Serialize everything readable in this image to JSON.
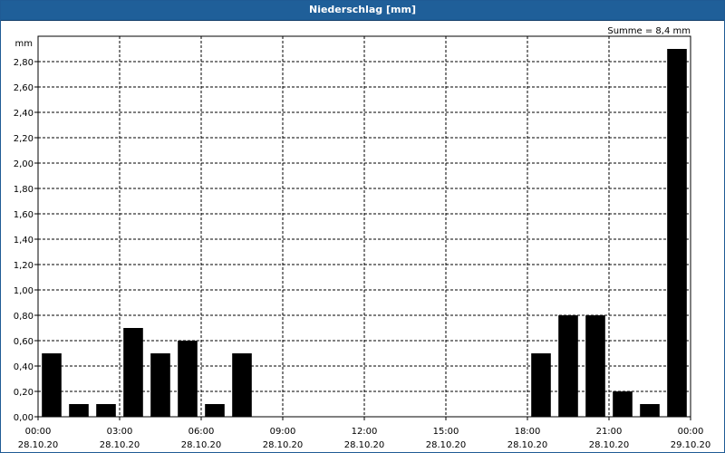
{
  "window": {
    "title": "Niederschlag [mm]"
  },
  "chart_data": {
    "type": "bar",
    "title": "Niederschlag [mm]",
    "ylabel": "mm",
    "annotation": "Summe = 8,4 mm",
    "ylim": [
      0,
      3.0
    ],
    "yticks": [
      "0,00",
      "0,20",
      "0,40",
      "0,60",
      "0,80",
      "1,00",
      "1,20",
      "1,40",
      "1,60",
      "1,80",
      "2,00",
      "2,20",
      "2,40",
      "2,60",
      "2,80"
    ],
    "xticks": [
      {
        "time": "00:00",
        "date": "28.10.20"
      },
      {
        "time": "03:00",
        "date": "28.10.20"
      },
      {
        "time": "06:00",
        "date": "28.10.20"
      },
      {
        "time": "09:00",
        "date": "28.10.20"
      },
      {
        "time": "12:00",
        "date": "28.10.20"
      },
      {
        "time": "15:00",
        "date": "28.10.20"
      },
      {
        "time": "18:00",
        "date": "28.10.20"
      },
      {
        "time": "21:00",
        "date": "28.10.20"
      },
      {
        "time": "00:00",
        "date": "29.10.20"
      }
    ],
    "bar_color": "#000000",
    "grid": true,
    "categories": [
      "00:00",
      "01:00",
      "02:00",
      "03:00",
      "04:00",
      "05:00",
      "06:00",
      "07:00",
      "08:00",
      "09:00",
      "10:00",
      "11:00",
      "12:00",
      "13:00",
      "14:00",
      "15:00",
      "16:00",
      "17:00",
      "18:00",
      "19:00",
      "20:00",
      "21:00",
      "22:00",
      "23:00"
    ],
    "values": [
      0.5,
      0.1,
      0.1,
      0.7,
      0.5,
      0.6,
      0.1,
      0.5,
      0,
      0,
      0,
      0,
      0,
      0,
      0,
      0,
      0,
      0,
      0.5,
      0.8,
      0.8,
      0.2,
      0.1,
      2.9
    ]
  }
}
